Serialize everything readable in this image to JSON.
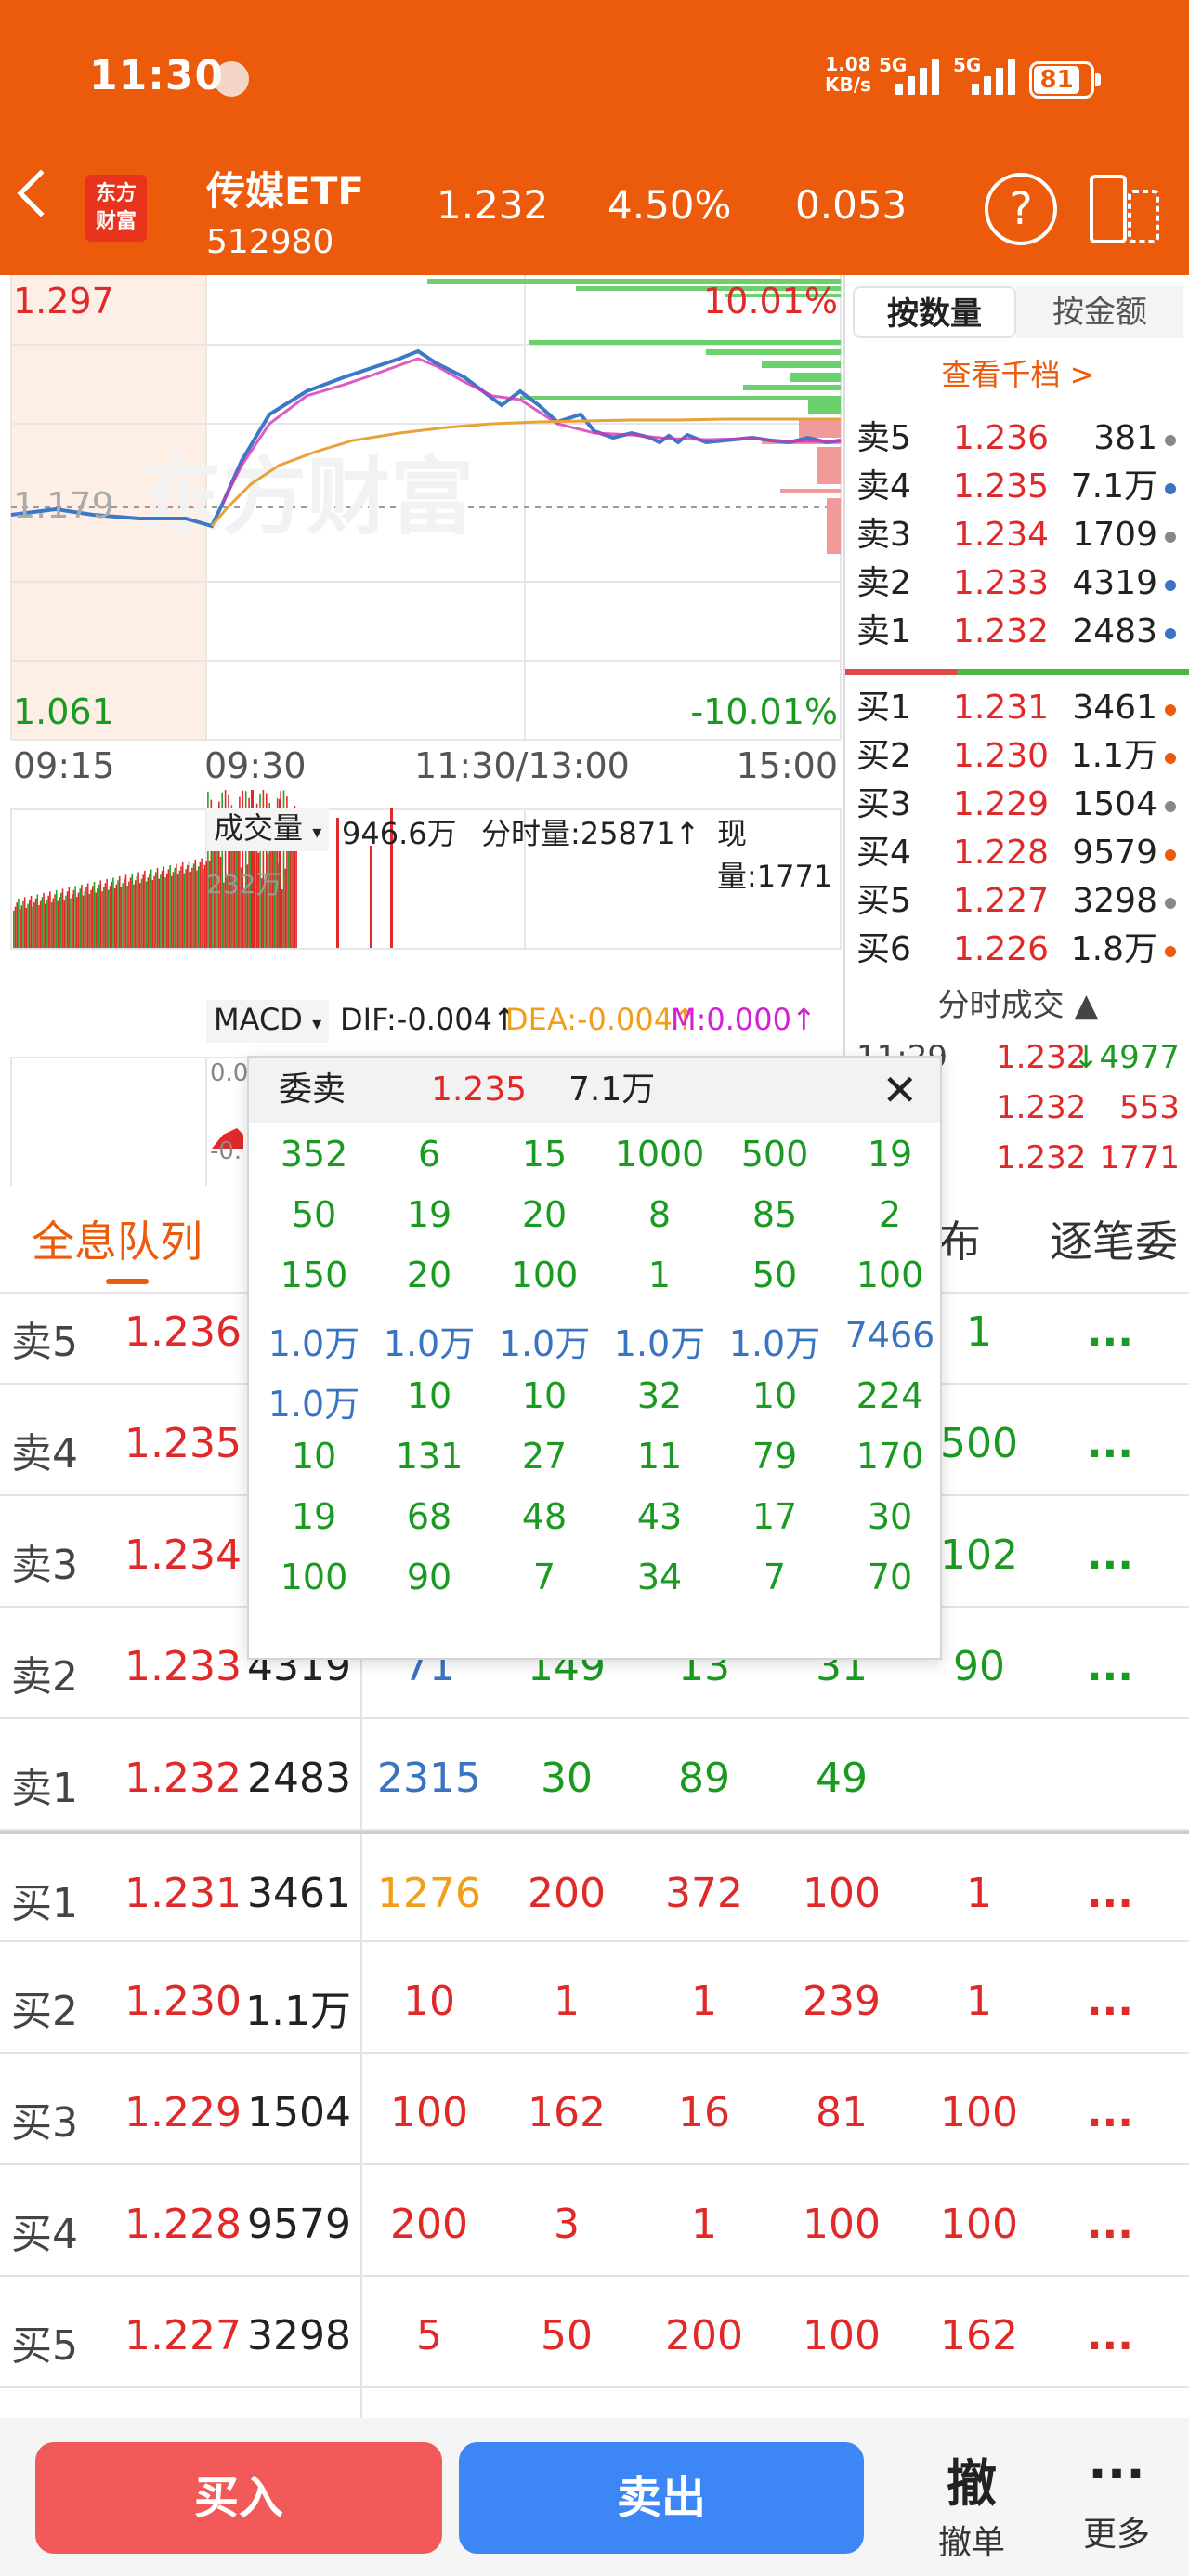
{
  "status": {
    "time": "11:30",
    "net_speed": "1.08",
    "net_unit": "KB/s",
    "sig1": "5G",
    "sig2": "5G",
    "battery": "81"
  },
  "header": {
    "logo": "东方财富",
    "name": "传媒ETF",
    "code": "512980",
    "price": "1.232",
    "pct": "4.50%",
    "change": "0.053"
  },
  "chart": {
    "high": "1.297",
    "low": "1.061",
    "mid": "1.179",
    "up_pct": "10.01%",
    "down_pct": "-10.01%",
    "watermark": "东方财富",
    "times": [
      "09:15",
      "09:30",
      "11:30/13:00",
      "15:00"
    ],
    "vol_sel": "成交量",
    "vol_total": "946.6万",
    "tick_vol": "分时量:25871",
    "cur_vol": "现量:1771",
    "vol_scale": "232万",
    "macd": "MACD",
    "dif": "DIF:-0.004",
    "dea": "DEA:-0.004",
    "m": "M:0.000",
    "macd_top": "0.0",
    "macd_bot": "-0."
  },
  "panel": {
    "tab_qty": "按数量",
    "tab_amt": "按金额",
    "view_more": "查看千档 >",
    "asks": [
      {
        "l": "卖5",
        "p": "1.236",
        "v": "381"
      },
      {
        "l": "卖4",
        "p": "1.235",
        "v": "7.1万"
      },
      {
        "l": "卖3",
        "p": "1.234",
        "v": "1709"
      },
      {
        "l": "卖2",
        "p": "1.233",
        "v": "4319"
      },
      {
        "l": "卖1",
        "p": "1.232",
        "v": "2483"
      }
    ],
    "bids": [
      {
        "l": "买1",
        "p": "1.231",
        "v": "3461"
      },
      {
        "l": "买2",
        "p": "1.230",
        "v": "1.1万"
      },
      {
        "l": "买3",
        "p": "1.229",
        "v": "1504"
      },
      {
        "l": "买4",
        "p": "1.228",
        "v": "9579"
      },
      {
        "l": "买5",
        "p": "1.227",
        "v": "3298"
      },
      {
        "l": "买6",
        "p": "1.226",
        "v": "1.8万"
      }
    ],
    "trades_title": "分时成交",
    "trades": [
      {
        "t": "11:29",
        "p": "1.232",
        "v": "4977"
      },
      {
        "t": "",
        "p": "1.232",
        "v": "553"
      },
      {
        "t": "",
        "p": "1.232",
        "v": "1771"
      }
    ]
  },
  "tabs": {
    "active": "全息队列",
    "t2": "布",
    "t3": "逐笔委"
  },
  "queue": [
    {
      "l": "卖5",
      "p": "1.236",
      "v": "",
      "c": [
        "",
        "",
        "",
        "",
        "1"
      ],
      "more": "..."
    },
    {
      "l": "卖4",
      "p": "1.235",
      "v": "",
      "c": [
        "",
        "",
        "",
        "",
        "500"
      ],
      "more": "..."
    },
    {
      "l": "卖3",
      "p": "1.234",
      "v": "",
      "c": [
        "",
        "",
        "",
        "",
        "102"
      ],
      "more": "..."
    },
    {
      "l": "卖2",
      "p": "1.233",
      "v": "4319",
      "c": [
        "71",
        "149",
        "13",
        "31",
        "90"
      ],
      "more": "..."
    },
    {
      "l": "卖1",
      "p": "1.232",
      "v": "2483",
      "c": [
        "2315",
        "30",
        "89",
        "49",
        ""
      ],
      "more": ""
    },
    {
      "l": "买1",
      "p": "1.231",
      "v": "3461",
      "c": [
        "1276",
        "200",
        "372",
        "100",
        "1"
      ],
      "more": "..."
    },
    {
      "l": "买2",
      "p": "1.230",
      "v": "1.1万",
      "c": [
        "10",
        "1",
        "1",
        "239",
        "1"
      ],
      "more": "..."
    },
    {
      "l": "买3",
      "p": "1.229",
      "v": "1504",
      "c": [
        "100",
        "162",
        "16",
        "81",
        "100"
      ],
      "more": "..."
    },
    {
      "l": "买4",
      "p": "1.228",
      "v": "9579",
      "c": [
        "200",
        "3",
        "1",
        "100",
        "100"
      ],
      "more": "..."
    },
    {
      "l": "买5",
      "p": "1.227",
      "v": "3298",
      "c": [
        "5",
        "50",
        "200",
        "100",
        "162"
      ],
      "more": "..."
    }
  ],
  "popup": {
    "title": "委卖",
    "price": "1.235",
    "vol": "7.1万",
    "rows": [
      [
        "352",
        "6",
        "15",
        "1000",
        "500",
        "19"
      ],
      [
        "50",
        "19",
        "20",
        "8",
        "85",
        "2"
      ],
      [
        "150",
        "20",
        "100",
        "1",
        "50",
        "100"
      ],
      [
        "1.0万",
        "1.0万",
        "1.0万",
        "1.0万",
        "1.0万",
        "7466"
      ],
      [
        "1.0万",
        "10",
        "10",
        "32",
        "10",
        "224"
      ],
      [
        "10",
        "131",
        "27",
        "11",
        "79",
        "170"
      ],
      [
        "19",
        "68",
        "48",
        "43",
        "17",
        "30"
      ],
      [
        "100",
        "90",
        "7",
        "34",
        "7",
        "70"
      ]
    ]
  },
  "bottom": {
    "buy": "买入",
    "sell": "卖出",
    "cancel_glyph": "撤",
    "cancel": "撤单",
    "more_glyph": "···",
    "more": "更多"
  },
  "colors": {
    "theme": "#ec5a0c",
    "red": "#e02a2a",
    "green": "#1a9a20",
    "blue": "#3a74c0",
    "buy_btn": "#f25a5a",
    "sell_btn": "#3d86f5"
  }
}
